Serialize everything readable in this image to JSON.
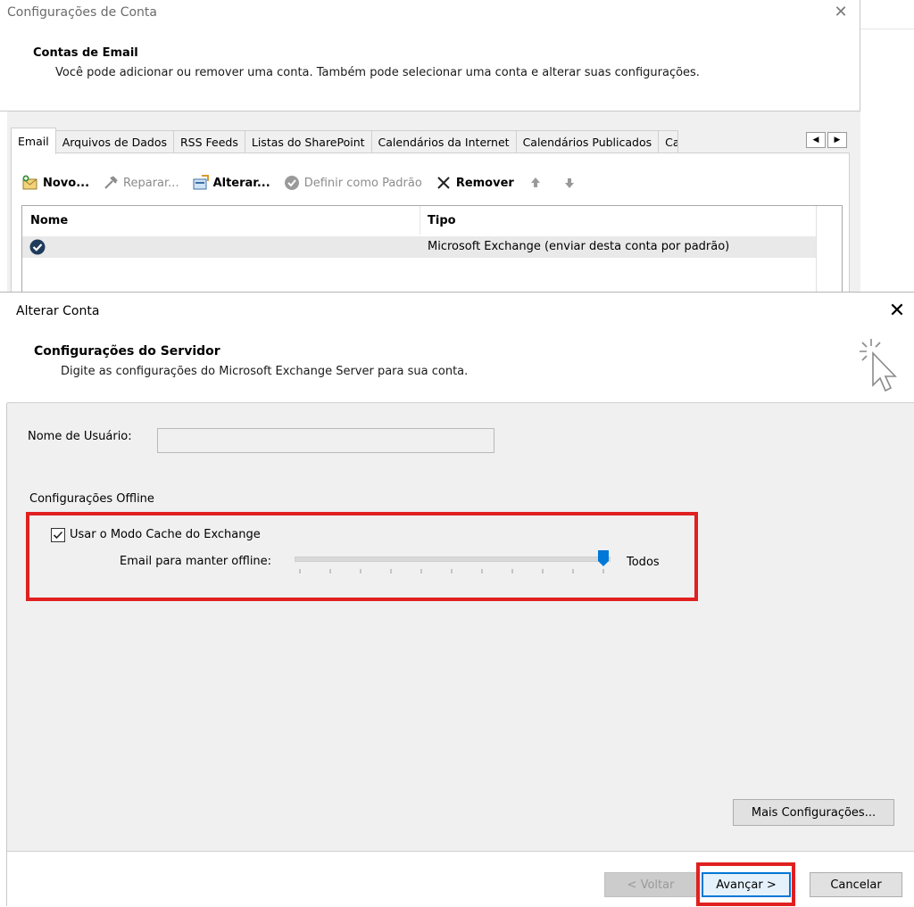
{
  "account_settings": {
    "title": "Configurações de Conta",
    "close_glyph": "✕",
    "heading": "Contas de Email",
    "description": "Você pode adicionar ou remover uma conta. Também pode selecionar uma conta e alterar suas configurações.",
    "tabs": [
      "Email",
      "Arquivos de Dados",
      "RSS Feeds",
      "Listas do SharePoint",
      "Calendários da Internet",
      "Calendários Publicados",
      "Ca"
    ],
    "toolbar": {
      "new": "Novo...",
      "repair": "Reparar...",
      "change": "Alterar...",
      "set_default": "Definir como Padrão",
      "remove": "Remover"
    },
    "list": {
      "col_name": "Nome",
      "col_type": "Tipo",
      "rows": [
        {
          "name": "",
          "type": "Microsoft Exchange (enviar desta conta por padrão)"
        }
      ]
    }
  },
  "change_account": {
    "title": "Alterar Conta",
    "close_glyph": "✕",
    "heading": "Configurações do Servidor",
    "description": "Digite as configurações do Microsoft Exchange Server para sua conta.",
    "username_label": "Nome de Usuário:",
    "username_value": "",
    "offline_section": "Configurações Offline",
    "cache_mode_label": "Usar o Modo Cache do Exchange",
    "cache_mode_checked": true,
    "keep_offline_label": "Email para manter offline:",
    "keep_offline_value": "Todos",
    "keep_offline_slider_fraction": 1.0,
    "more_settings_button": "Mais Configurações...",
    "back_button": "< Voltar",
    "next_button": "Avançar >",
    "cancel_button": "Cancelar"
  },
  "colors": {
    "highlight": "#e02020",
    "accent": "#0078d7",
    "panel_bg": "#f0f0f0"
  },
  "icons": [
    "mail-new-icon",
    "repair-icon",
    "change-icon",
    "default-check-icon",
    "remove-x-icon",
    "move-up-icon",
    "move-down-icon",
    "default-account-icon",
    "cursor-click-icon"
  ]
}
